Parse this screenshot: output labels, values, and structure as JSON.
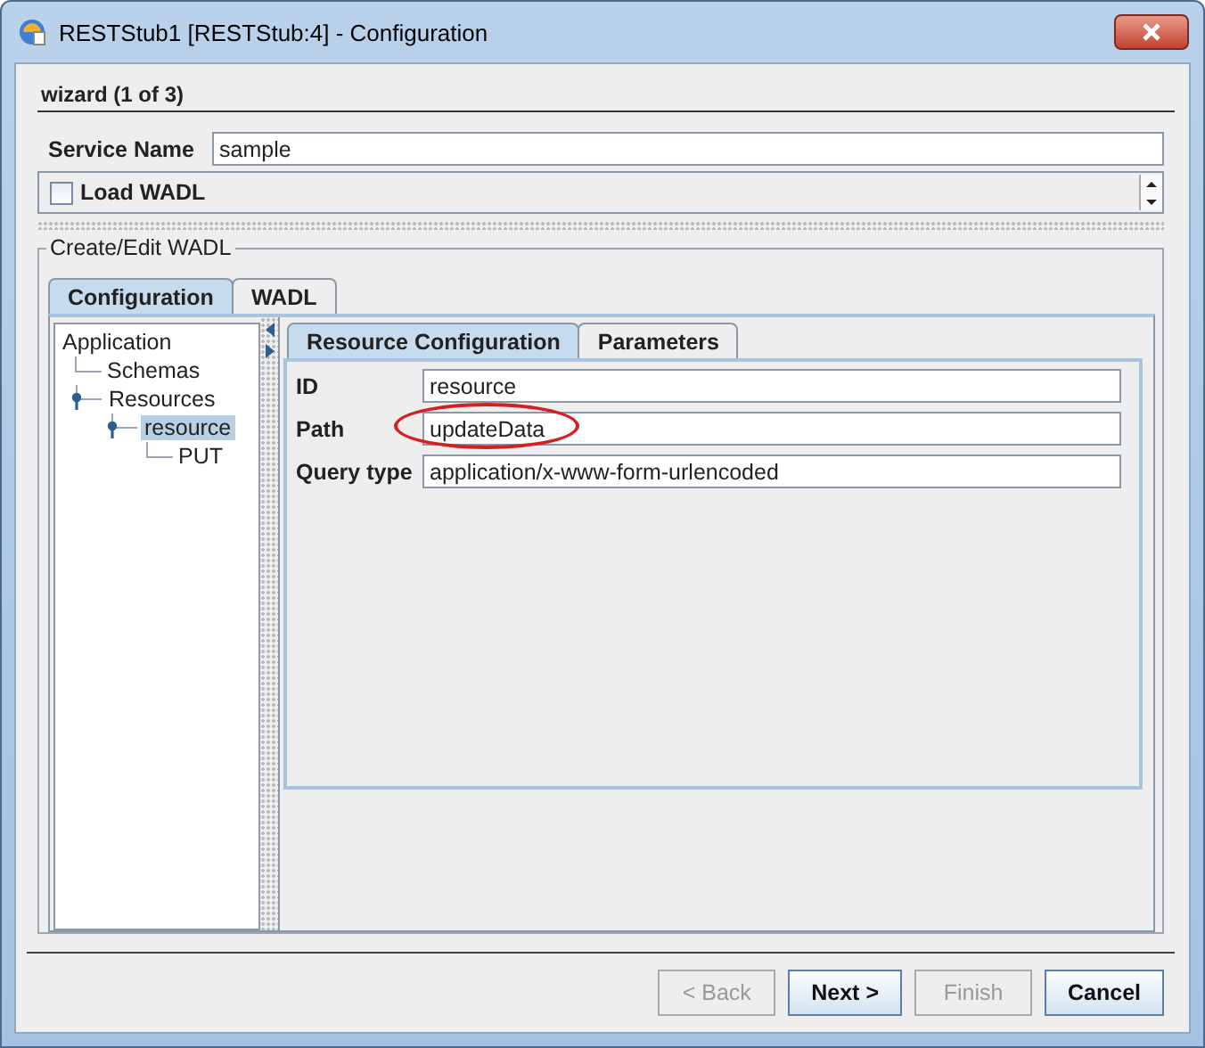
{
  "window": {
    "title": "RESTStub1 [RESTStub:4] - Configuration"
  },
  "wizard": {
    "title": "wizard (1 of 3)"
  },
  "service_name": {
    "label": "Service Name",
    "value": "sample"
  },
  "load_wadl": {
    "label": "Load WADL",
    "checked": false
  },
  "group": {
    "title": "Create/Edit WADL"
  },
  "tabs": [
    {
      "label": "Configuration",
      "selected": true
    },
    {
      "label": "WADL",
      "selected": false
    }
  ],
  "tree": [
    {
      "label": "Application",
      "selected": false,
      "children": [
        {
          "label": "Schemas",
          "selected": false
        },
        {
          "label": "Resources",
          "selected": false,
          "children": [
            {
              "label": "resource",
              "selected": true,
              "children": [
                {
                  "label": "PUT",
                  "selected": false
                }
              ]
            }
          ]
        }
      ]
    }
  ],
  "inner_tabs": [
    {
      "label": "Resource Configuration",
      "selected": true
    },
    {
      "label": "Parameters",
      "selected": false
    }
  ],
  "fields": [
    {
      "label": "ID",
      "value": "resource",
      "highlighted": false
    },
    {
      "label": "Path",
      "value": "updateData",
      "highlighted": true
    },
    {
      "label": "Query type",
      "value": "application/x-www-form-urlencoded",
      "highlighted": false
    }
  ],
  "buttons": [
    {
      "label": "< Back",
      "disabled": true
    },
    {
      "label": "Next >",
      "disabled": false
    },
    {
      "label": "Finish",
      "disabled": true
    },
    {
      "label": "Cancel",
      "disabled": false
    }
  ]
}
